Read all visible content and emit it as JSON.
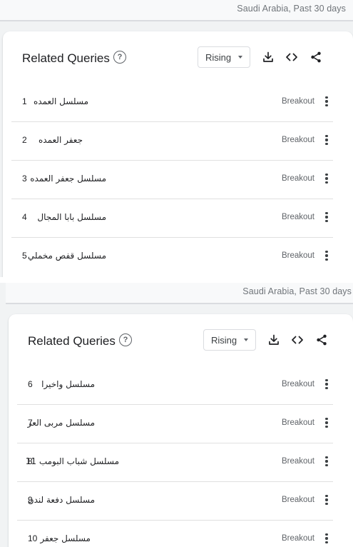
{
  "region_label": "Saudi Arabia, Past 30 days",
  "card_title": "Related Queries",
  "help_glyph": "?",
  "sort_dropdown": {
    "selected": "Rising"
  },
  "toolbar_icons": [
    "download-icon",
    "embed-code-icon",
    "share-icon"
  ],
  "colors": {
    "text": "#202124",
    "muted": "#5f6368",
    "divider": "#e0e0e0",
    "background": "#f1f3f4"
  },
  "panel1": {
    "rows": [
      {
        "rank": "1",
        "query": "مسلسل العمده",
        "value": "Breakout"
      },
      {
        "rank": "2",
        "query": "جعفر العمده",
        "value": "Breakout"
      },
      {
        "rank": "3",
        "query": "مسلسل جعفر العمده",
        "value": "Breakout"
      },
      {
        "rank": "4",
        "query": "مسلسل بابا المجال",
        "value": "Breakout"
      },
      {
        "rank": "5",
        "query": "مسلسل قفص مخملي",
        "value": "Breakout"
      }
    ]
  },
  "panel2": {
    "rows": [
      {
        "rank": "6",
        "query": "مسلسل واخيرا",
        "value": "Breakout"
      },
      {
        "rank": "7",
        "query": "مسلسل مربى العز",
        "value": "Breakout"
      },
      {
        "rank": "8",
        "query": "مسلسل شباب البومب 11",
        "value": "Breakout"
      },
      {
        "rank": "9",
        "query": "مسلسل دفعة لندن",
        "value": "Breakout"
      },
      {
        "rank": "10",
        "query": "مسلسل جعفر",
        "value": "Breakout"
      }
    ]
  }
}
